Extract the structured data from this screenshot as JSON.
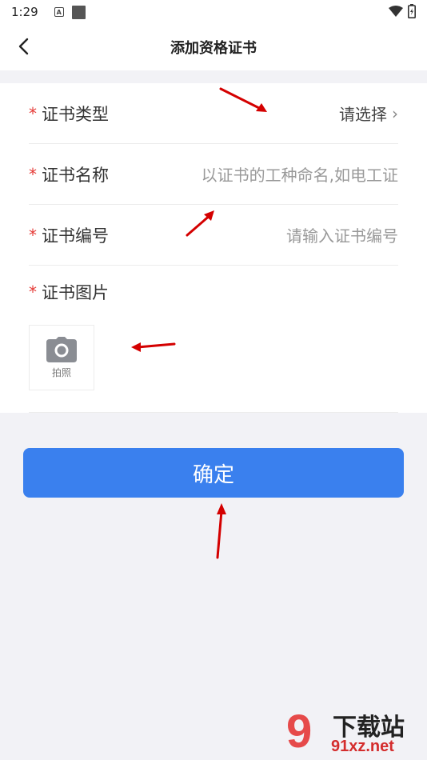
{
  "status_bar": {
    "time": "1:29",
    "badge_letter": "A"
  },
  "header": {
    "title": "添加资格证书"
  },
  "form": {
    "required_mark": "*",
    "certificate_type": {
      "label": "证书类型",
      "value": "请选择",
      "chevron": "›"
    },
    "certificate_name": {
      "label": "证书名称",
      "placeholder": "以证书的工种命名,如电工证"
    },
    "certificate_number": {
      "label": "证书编号",
      "placeholder": "请输入证书编号"
    },
    "certificate_image": {
      "label": "证书图片",
      "photo_caption": "拍照",
      "icon": "camera-icon"
    }
  },
  "confirm_button": {
    "label": "确定"
  },
  "watermark": {
    "line1": "下载站",
    "line2": "91xz.net",
    "logo": "9"
  },
  "colors": {
    "accent": "#3a80ee",
    "required": "#e53935",
    "annotation_arrow": "#d40000",
    "background": "#f2f2f6"
  }
}
